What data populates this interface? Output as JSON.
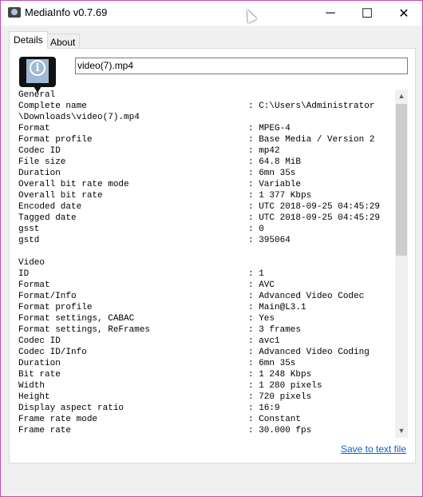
{
  "window": {
    "title": "MediaInfo v0.7.69",
    "minimize": "─",
    "maximize": "☐",
    "close": "✕"
  },
  "tabs": [
    {
      "label": "Details",
      "active": true
    },
    {
      "label": "About",
      "active": false
    }
  ],
  "file_name": "video(7).mp4",
  "rows": [
    [
      "General",
      ""
    ],
    [
      "Complete name",
      ": C:\\Users\\Administrator"
    ],
    [
      "\\Downloads\\video(7).mp4",
      ""
    ],
    [
      "Format",
      ": MPEG-4"
    ],
    [
      "Format profile",
      ": Base Media / Version 2"
    ],
    [
      "Codec ID",
      ": mp42"
    ],
    [
      "File size",
      ": 64.8 MiB"
    ],
    [
      "Duration",
      ": 6mn 35s"
    ],
    [
      "Overall bit rate mode",
      ": Variable"
    ],
    [
      "Overall bit rate",
      ": 1 377 Kbps"
    ],
    [
      "Encoded date",
      ": UTC 2018-09-25 04:45:29"
    ],
    [
      "Tagged date",
      ": UTC 2018-09-25 04:45:29"
    ],
    [
      "gsst",
      ": 0"
    ],
    [
      "gstd",
      ": 395064"
    ],
    [
      "",
      ""
    ],
    [
      "Video",
      ""
    ],
    [
      "ID",
      ": 1"
    ],
    [
      "Format",
      ": AVC"
    ],
    [
      "Format/Info",
      ": Advanced Video Codec"
    ],
    [
      "Format profile",
      ": Main@L3.1"
    ],
    [
      "Format settings, CABAC",
      ": Yes"
    ],
    [
      "Format settings, ReFrames",
      ": 3 frames"
    ],
    [
      "Codec ID",
      ": avc1"
    ],
    [
      "Codec ID/Info",
      ": Advanced Video Coding"
    ],
    [
      "Duration",
      ": 6mn 35s"
    ],
    [
      "Bit rate",
      ": 1 248 Kbps"
    ],
    [
      "Width",
      ": 1 280 pixels"
    ],
    [
      "Height",
      ": 720 pixels"
    ],
    [
      "Display aspect ratio",
      ": 16:9"
    ],
    [
      "Frame rate mode",
      ": Constant"
    ],
    [
      "Frame rate",
      ": 30.000 fps"
    ]
  ],
  "save_link": "Save to text file",
  "colors": {
    "link": "#0066cc",
    "border": "#c050b0"
  }
}
